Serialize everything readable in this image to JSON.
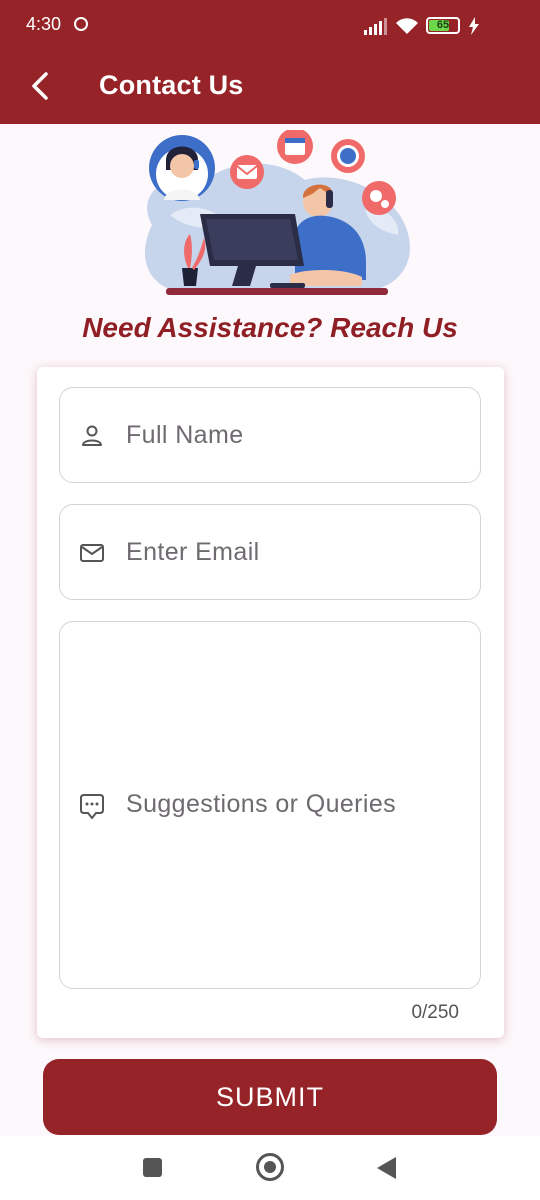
{
  "status_bar": {
    "time": "4:30",
    "battery": "65"
  },
  "header": {
    "title": "Contact Us",
    "back_icon": "chevron-left-icon"
  },
  "hero": {
    "illustration": "customer-support-illustration"
  },
  "tagline": "Need Assistance? Reach Us",
  "form": {
    "name": {
      "placeholder": "Full Name",
      "icon": "person-icon"
    },
    "email": {
      "placeholder": "Enter Email",
      "icon": "mail-icon"
    },
    "message": {
      "placeholder": "Suggestions or Queries",
      "icon": "chat-bubble-icon"
    },
    "counter": "0/250"
  },
  "submit_label": "SUBMIT",
  "colors": {
    "primary": "#962328",
    "background": "#fdf8fb",
    "placeholder": "#6e6a70"
  }
}
